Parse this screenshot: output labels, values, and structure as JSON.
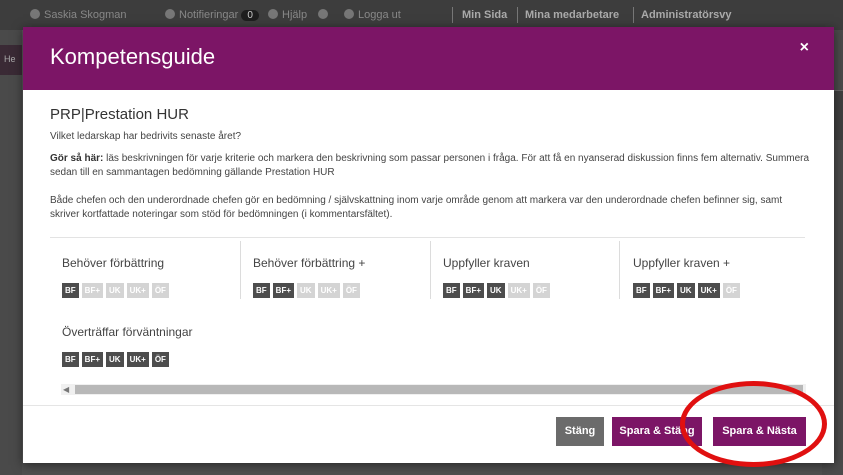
{
  "topbar": {
    "user": "Saskia Skogman",
    "notifications_label": "Notifieringar",
    "notifications_count": "0",
    "help": "Hjälp",
    "logout": "Logga ut",
    "nav": [
      "Min Sida",
      "Mina medarbetare",
      "Administratörsvy"
    ]
  },
  "sidebar": {
    "partial_label": "He"
  },
  "modal": {
    "title": "Kompetensguide",
    "close_symbol": "×",
    "section_title": "PRP|Prestation HUR",
    "question": "Vilket ledarskap har bedrivits senaste året?",
    "instructions_bold": "Gör så här:",
    "instructions_text": " läs beskrivningen för varje kriterie och markera den beskrivning som passar personen i fråga. För att få en nyanserad diskussion finns fem alternativ. Summera sedan till en sammantagen bedömning gällande Prestation HUR",
    "instructions_2": "Både chefen och den underordnade chefen gör en bedömning / självskattning inom varje område genom att markera var den underordnade chefen befinner sig, samt skriver kortfattade noteringar som stöd för bedömningen (i kommentarsfältet).",
    "criteria": [
      {
        "label": "Behöver förbättring",
        "level": 1
      },
      {
        "label": "Behöver förbättring +",
        "level": 2
      },
      {
        "label": "Uppfyller kraven",
        "level": 3
      },
      {
        "label": "Uppfyller kraven +",
        "level": 4
      },
      {
        "label": "Överträffar förväntningar",
        "level": 5
      }
    ],
    "badge_labels": [
      "BF",
      "BF+",
      "UK",
      "UK+",
      "ÖF"
    ],
    "buttons": {
      "close": "Stäng",
      "save_close": "Spara & Stäng",
      "save_next": "Spara & Nästa"
    }
  },
  "colors": {
    "primary": "#7c1566",
    "badge_active": "#4d4d4d",
    "badge_inactive": "#d4d4d4",
    "annotation": "#e01010"
  },
  "icons": [
    "user-icon",
    "bell-icon",
    "help-icon",
    "info-icon",
    "logout-icon",
    "close-icon",
    "scroll-left-arrow-icon"
  ]
}
